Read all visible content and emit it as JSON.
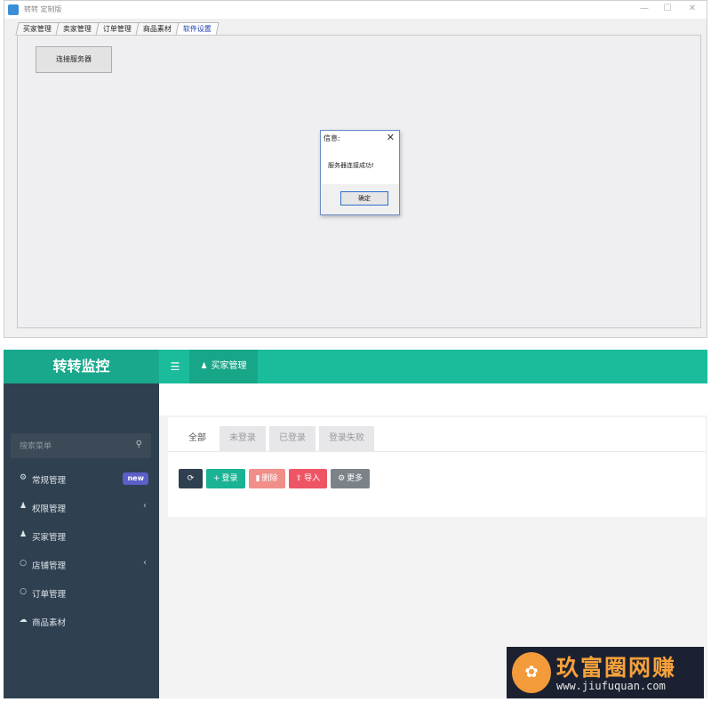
{
  "window": {
    "title": "转转 定制版",
    "controls": [
      "—",
      "☐",
      "✕"
    ],
    "tabs": [
      "买家管理",
      "卖家管理",
      "订单管理",
      "商品素材",
      "软件设置"
    ],
    "active_tab": "软件设置",
    "connect_button": "连接服务器",
    "dialog": {
      "title": "信息:",
      "close": "✕",
      "message": "服务器连接成功!",
      "ok_button": "确定"
    }
  },
  "admin": {
    "brand": "转转监控",
    "menu_icon": "☰",
    "top_tab": {
      "icon": "user-icon",
      "glyph": "♟",
      "label": "买家管理"
    },
    "search": {
      "placeholder": "搜索菜单",
      "icon": "⚲"
    },
    "nav": [
      {
        "icon": "cogs-icon",
        "glyph": "⚙",
        "label": "常规管理",
        "badge": "new"
      },
      {
        "icon": "users-icon",
        "glyph": "♟",
        "label": "权限管理",
        "arrow": "‹"
      },
      {
        "icon": "user-icon",
        "glyph": "♟",
        "label": "买家管理"
      },
      {
        "icon": "circle-icon",
        "glyph": "○",
        "label": "店铺管理",
        "arrow": "‹"
      },
      {
        "icon": "circle-icon",
        "glyph": "○",
        "label": "订单管理"
      },
      {
        "icon": "cloud-icon",
        "glyph": "☁",
        "label": "商品素材"
      }
    ],
    "subtabs": [
      "全部",
      "未登录",
      "已登录",
      "登录失败"
    ],
    "actions": {
      "refresh": "⟳",
      "login": "登录",
      "delete": "删除",
      "import": "导入",
      "more": "更多"
    },
    "colors": {
      "topbar": "#1abc9c",
      "sidebar": "#2f4050",
      "login": "#1ab394",
      "delete": "#f08f8a",
      "import": "#ed5565",
      "more": "#7b8288",
      "badge": "#5b5fc7"
    }
  },
  "watermark": {
    "name": "玖富圈网赚",
    "url": "www.jiufuquan.com",
    "logo_glyph": "✿"
  }
}
